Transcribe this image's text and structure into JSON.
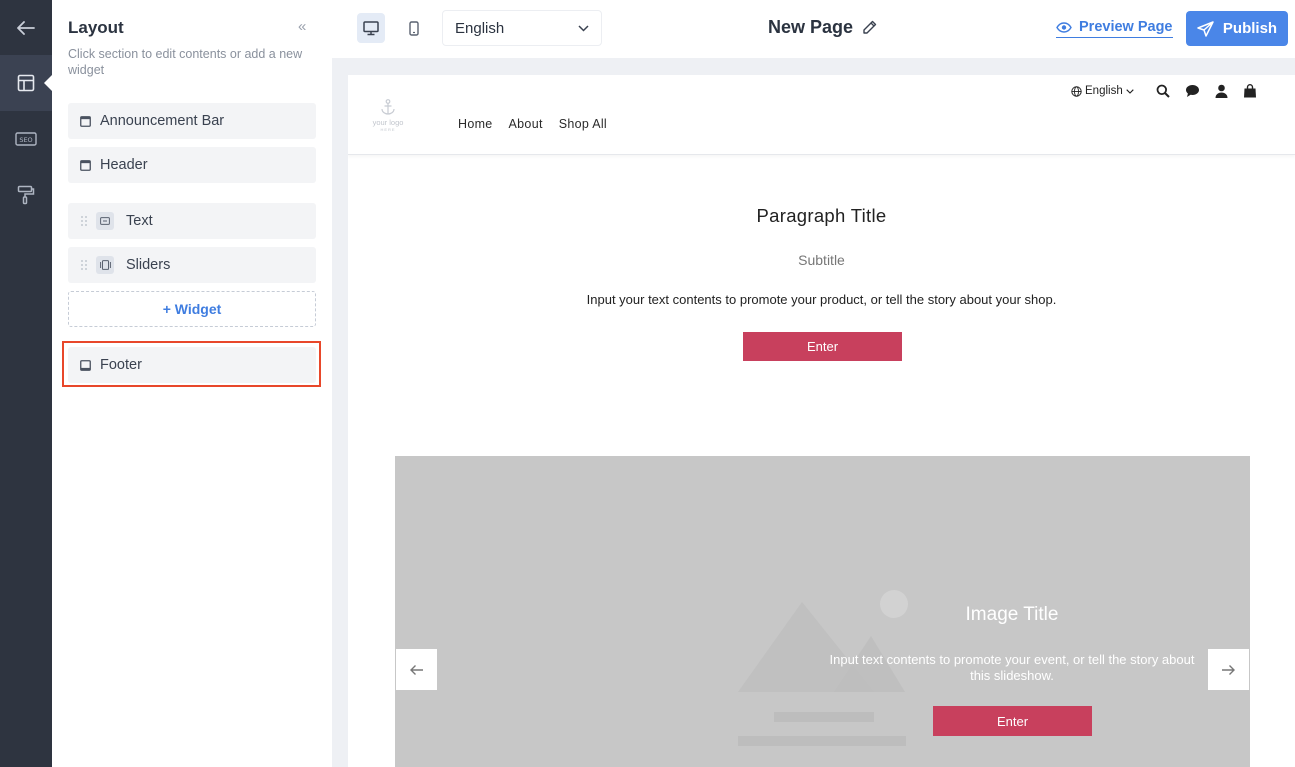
{
  "sidebar": {
    "title": "Layout",
    "description": "Click section to edit contents or add a new widget",
    "sections": {
      "announcement": "Announcement Bar",
      "header": "Header",
      "text_widget": "Text",
      "sliders_widget": "Sliders",
      "footer": "Footer"
    },
    "add_widget": "+ Widget"
  },
  "toolbar": {
    "language": "English",
    "page_title": "New Page",
    "preview": "Preview Page",
    "publish": "Publish"
  },
  "site": {
    "logo_text": "your logo",
    "logo_sub": "HERE",
    "nav": [
      "Home",
      "About",
      "Shop All"
    ],
    "language": "English",
    "paragraph": {
      "title": "Paragraph Title",
      "subtitle": "Subtitle",
      "body": "Input your text contents to promote your product, or tell the story about your shop.",
      "button": "Enter"
    },
    "slide": {
      "title": "Image Title",
      "body": "Input text contents to promote your event, or tell the story about this slideshow.",
      "button": "Enter"
    }
  },
  "colors": {
    "accent": "#4a86e8",
    "highlight": "#e8472a",
    "site_button": "#c8405d"
  }
}
